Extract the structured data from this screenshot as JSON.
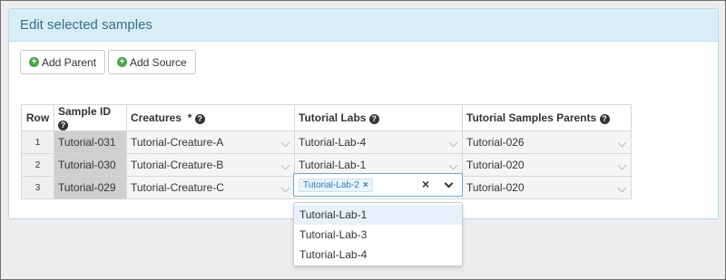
{
  "panel": {
    "title": "Edit selected samples"
  },
  "toolbar": {
    "add_parent_label": "Add Parent",
    "add_source_label": "Add Source"
  },
  "table": {
    "headers": {
      "row": "Row",
      "sample_id": "Sample ID",
      "creatures": "Creatures  *",
      "labs": "Tutorial Labs",
      "parents": "Tutorial Samples Parents"
    },
    "rows": [
      {
        "row": "1",
        "sample_id": "Tutorial-031",
        "creature": "Tutorial-Creature-A",
        "lab": "Tutorial-Lab-4",
        "parent": "Tutorial-026"
      },
      {
        "row": "2",
        "sample_id": "Tutorial-030",
        "creature": "Tutorial-Creature-B",
        "lab": "Tutorial-Lab-1",
        "parent": "Tutorial-020"
      },
      {
        "row": "3",
        "sample_id": "Tutorial-029",
        "creature": "Tutorial-Creature-C",
        "lab": "",
        "parent": "Tutorial-020"
      }
    ]
  },
  "active_select": {
    "selected_tag": "Tutorial-Lab-2",
    "tag_remove": "×",
    "clear": "×"
  },
  "dropdown": {
    "options": [
      "Tutorial-Lab-1",
      "Tutorial-Lab-3",
      "Tutorial-Lab-4"
    ]
  },
  "colors": {
    "heading_bg": "#d9edf7",
    "heading_text": "#31708f",
    "plus_green": "#4ca34c",
    "tag_text": "#2a7cc0"
  }
}
